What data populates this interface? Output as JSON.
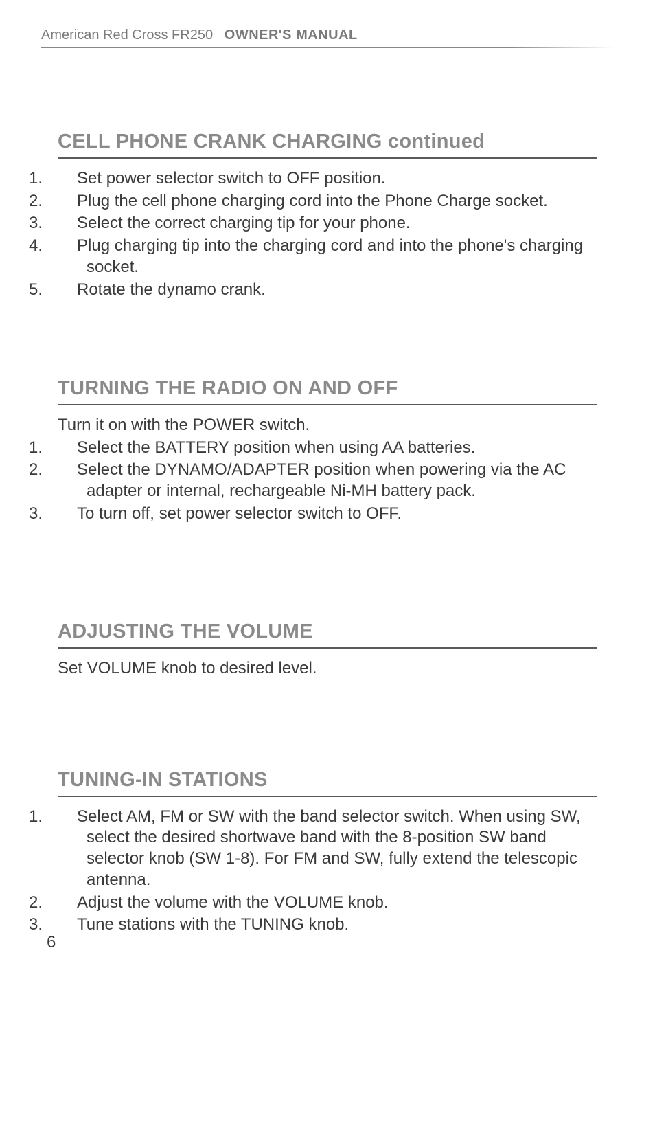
{
  "header": {
    "brand": "American Red Cross FR250",
    "label": "OWNER'S MANUAL"
  },
  "page_number": "6",
  "sections": [
    {
      "title": "CELL PHONE CRANK CHARGING continued",
      "intro": null,
      "items": [
        "Set power selector switch to OFF position.",
        "Plug the cell phone charging cord into the Phone Charge socket.",
        "Select the correct charging tip for your phone.",
        "Plug charging tip into the charging cord and into the phone's charging socket.",
        "Rotate the dynamo crank."
      ]
    },
    {
      "title": "TURNING THE RADIO ON AND OFF",
      "intro": "Turn it on with the POWER switch.",
      "items": [
        "Select the BATTERY position when using AA batteries.",
        "Select the DYNAMO/ADAPTER position when powering via the AC adapter or internal, rechargeable Ni-MH battery pack.",
        "To turn off, set power selector switch to OFF."
      ]
    },
    {
      "title": "ADJUSTING THE VOLUME",
      "intro": "Set VOLUME knob to desired level.",
      "items": []
    },
    {
      "title": "TUNING-IN STATIONS",
      "intro": null,
      "items": [
        "Select AM, FM or SW with the band selector switch. When using SW, select the desired shortwave band with the 8-position SW band selector knob (SW 1-8). For FM and SW, fully extend the telescopic antenna.",
        "Adjust the volume with the VOLUME knob.",
        "Tune stations with the TUNING knob."
      ]
    }
  ]
}
